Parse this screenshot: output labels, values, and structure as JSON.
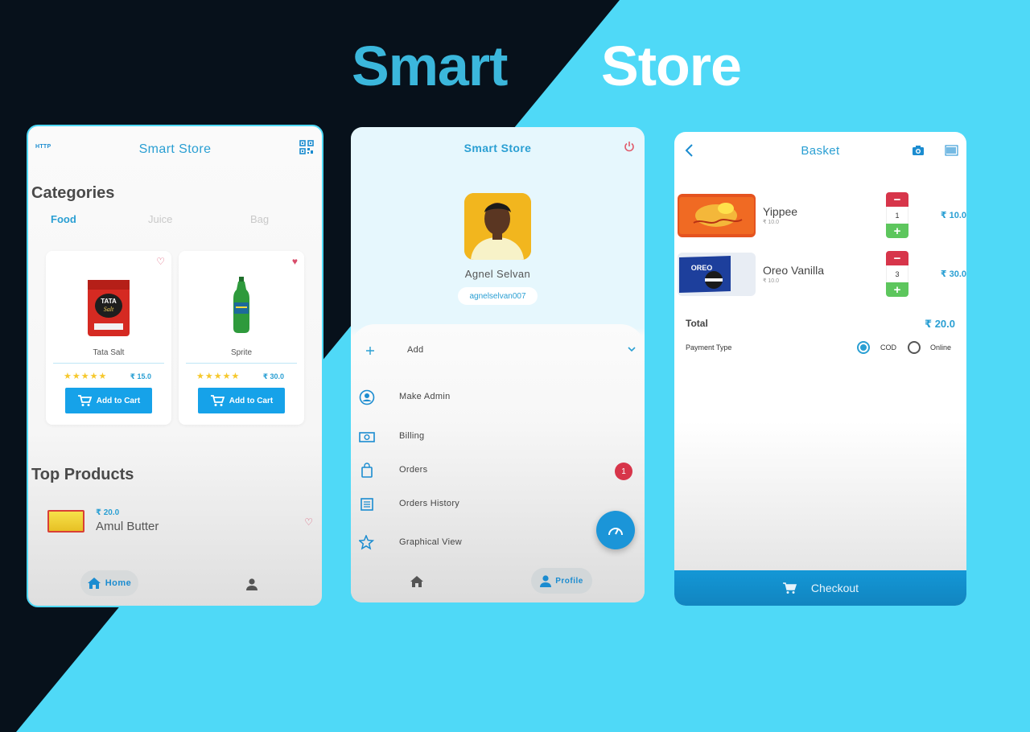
{
  "banner": {
    "word1": "Smart",
    "word2": "Store"
  },
  "home_screen": {
    "http_label": "HTTP",
    "title": "Smart Store",
    "categories_title": "Categories",
    "tabs": [
      {
        "label": "Food",
        "active": true
      },
      {
        "label": "Juice",
        "active": false
      },
      {
        "label": "Bag",
        "active": false
      }
    ],
    "products": [
      {
        "name": "Tata Salt",
        "price": "₹ 15.0",
        "rating": 5,
        "favorited": false,
        "button": "Add to Cart"
      },
      {
        "name": "Sprite",
        "price": "₹ 30.0",
        "rating": 5,
        "favorited": true,
        "button": "Add to Cart"
      }
    ],
    "top_products_title": "Top Products",
    "top_product": {
      "price": "₹ 20.0",
      "name": "Amul Butter"
    },
    "nav": {
      "home_label": "Home"
    }
  },
  "profile_screen": {
    "title": "Smart Store",
    "user_name": "Agnel Selvan",
    "handle": "agnelselvan007",
    "menu": {
      "add": "Add",
      "make_admin": "Make Admin",
      "billing": "Billing",
      "orders": "Orders",
      "orders_badge": "1",
      "orders_history": "Orders History",
      "graphical_view": "Graphical View"
    },
    "nav": {
      "profile_label": "Profile"
    }
  },
  "basket_screen": {
    "title": "Basket",
    "items": [
      {
        "name": "Yippee",
        "unit_price": "₹ 10.0",
        "qty": "1",
        "price": "₹ 10.0"
      },
      {
        "name": "Oreo Vanilla",
        "unit_price": "₹ 10.0",
        "qty": "3",
        "price": "₹ 30.0"
      }
    ],
    "total_label": "Total",
    "total_value": "₹ 20.0",
    "payment_type_label": "Payment Type",
    "payment_options": [
      "COD",
      "Online"
    ],
    "payment_selected": "COD",
    "checkout_label": "Checkout"
  },
  "colors": {
    "accent": "#2a9fd3",
    "button": "#16a2e9",
    "danger": "#d7354a",
    "success": "#5dc65d",
    "background": "#4fd9f7",
    "dark": "#07111b"
  }
}
